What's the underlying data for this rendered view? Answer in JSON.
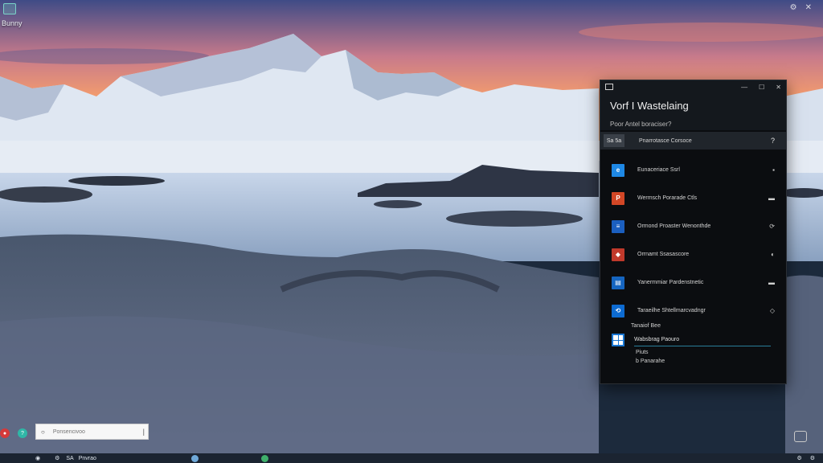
{
  "desktop": {
    "icon_label": "Bunny",
    "corner_icons": [
      "⚙",
      "✕"
    ]
  },
  "panel": {
    "title": "Vorf I Wastelaing",
    "subtitle": "Poor Antel boraciser?",
    "account": {
      "avatar_text": "Sa 5a",
      "label": "Pnarrotasce Corsoce",
      "help": "?"
    },
    "items": [
      {
        "label": "Eunaceriace Ssrl",
        "icon": "edge-icon",
        "color": "#1e88e5",
        "glyph": "e",
        "action": "▪"
      },
      {
        "label": "Wermsch Porarade Ctls",
        "icon": "powerpoint-icon",
        "color": "#d24726",
        "glyph": "P",
        "action": "▬"
      },
      {
        "label": "Ormond Proaster Wenonthde",
        "icon": "word-icon",
        "color": "#1b5fbf",
        "glyph": "≡",
        "action": "⟳"
      },
      {
        "label": "Orrnamt Ssasascore",
        "icon": "office-icon",
        "color": "#c0392b",
        "glyph": "◆",
        "action": "◐"
      },
      {
        "label": "Yanermmiar Pardenstnetic",
        "icon": "store-icon",
        "color": "#1565c0",
        "glyph": "▤",
        "action": "▬"
      },
      {
        "label": "Taraeilhe Shtellmarcvadngr",
        "icon": "sync-icon",
        "color": "#0d6bd1",
        "glyph": "⟲",
        "action": "◇"
      }
    ],
    "section": {
      "label": "Tanaiof Bee",
      "field_value": "Wabsbrag Paouro",
      "sub1": "Piuts",
      "sub2": "b Panarahe"
    }
  },
  "search": {
    "placeholder": "Ponsencivoo",
    "caret": "|"
  },
  "taskbar": {
    "items": [
      "◉",
      "⚙",
      "SA",
      "Pnvrao"
    ],
    "tray": [
      "⚙",
      "⚙"
    ]
  }
}
